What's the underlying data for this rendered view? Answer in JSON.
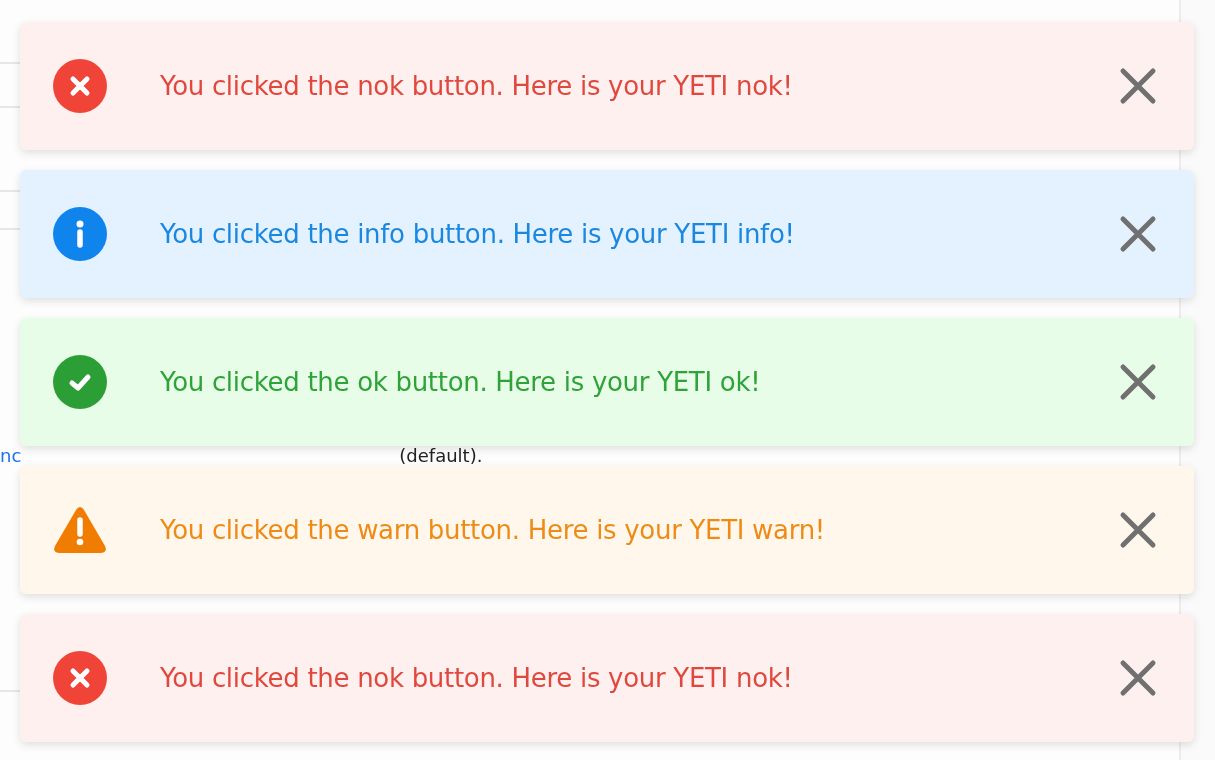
{
  "background": {
    "link_fragment": "nc",
    "text_fragment": "(default)."
  },
  "toasts": [
    {
      "kind": "error",
      "message": "You clicked the nok button. Here is your YETI nok!"
    },
    {
      "kind": "info",
      "message": "You clicked the info button. Here is your YETI info!"
    },
    {
      "kind": "success",
      "message": "You clicked the ok button. Here is your YETI ok!"
    },
    {
      "kind": "warning",
      "message": "You clicked the warn button. Here is your YETI warn!"
    },
    {
      "kind": "error",
      "message": "You clicked the nok button. Here is your YETI nok!"
    }
  ]
}
